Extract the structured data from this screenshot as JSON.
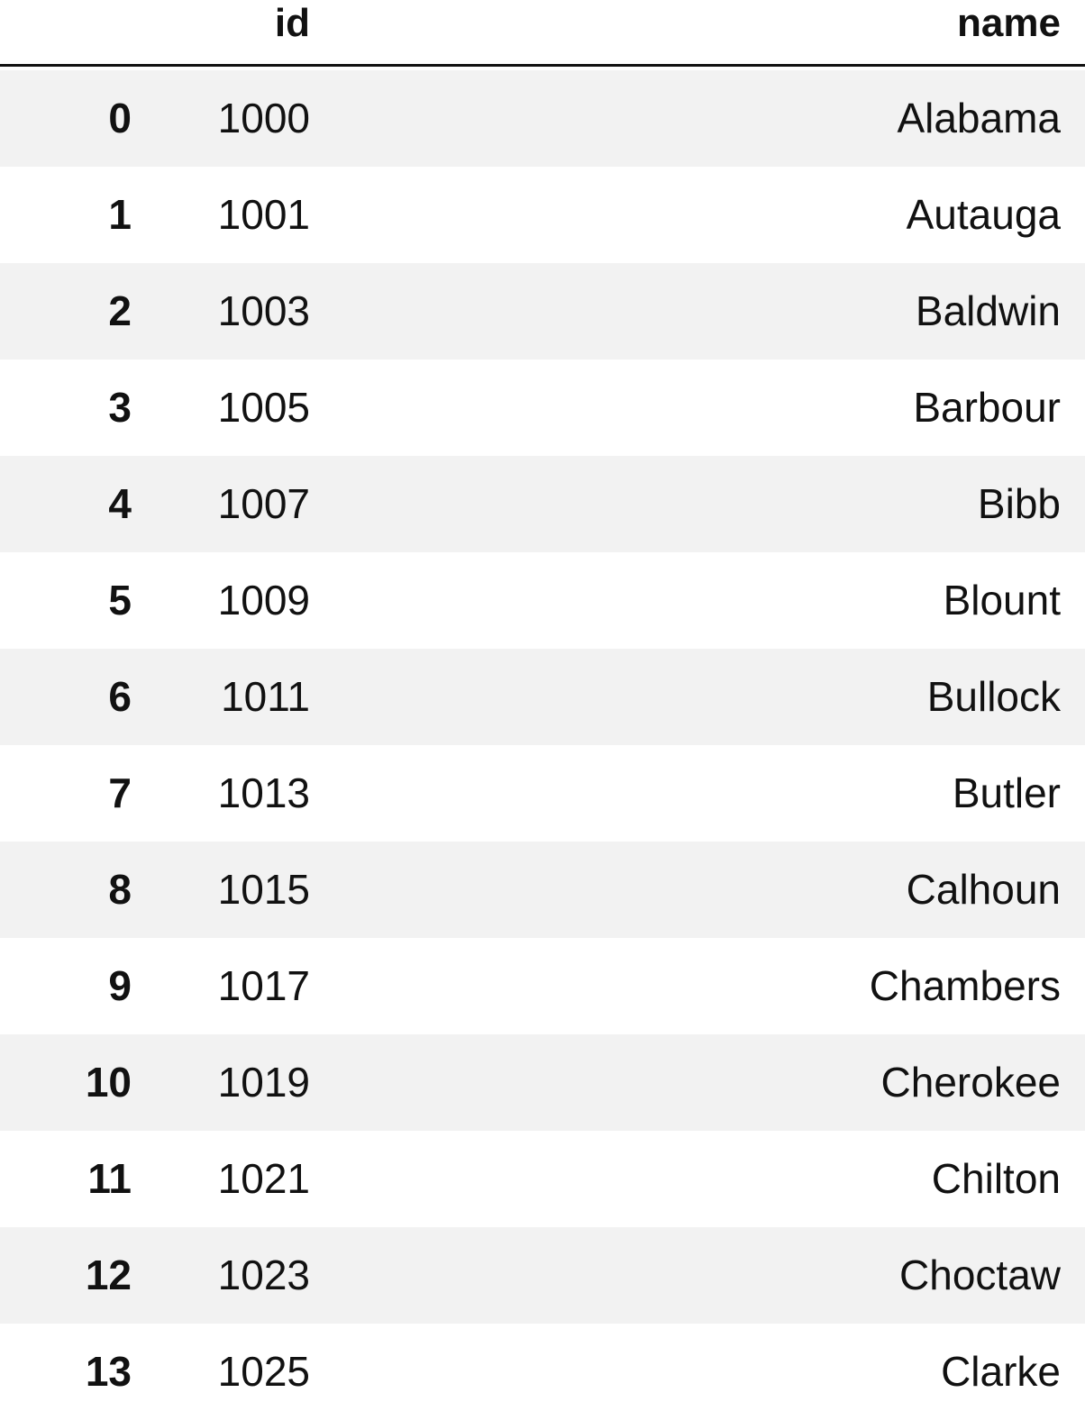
{
  "table": {
    "columns": {
      "index": "",
      "id": "id",
      "name": "name"
    },
    "rows": [
      {
        "index": "0",
        "id": "1000",
        "name": "Alabama"
      },
      {
        "index": "1",
        "id": "1001",
        "name": "Autauga"
      },
      {
        "index": "2",
        "id": "1003",
        "name": "Baldwin"
      },
      {
        "index": "3",
        "id": "1005",
        "name": "Barbour"
      },
      {
        "index": "4",
        "id": "1007",
        "name": "Bibb"
      },
      {
        "index": "5",
        "id": "1009",
        "name": "Blount"
      },
      {
        "index": "6",
        "id": "1011",
        "name": "Bullock"
      },
      {
        "index": "7",
        "id": "1013",
        "name": "Butler"
      },
      {
        "index": "8",
        "id": "1015",
        "name": "Calhoun"
      },
      {
        "index": "9",
        "id": "1017",
        "name": "Chambers"
      },
      {
        "index": "10",
        "id": "1019",
        "name": "Cherokee"
      },
      {
        "index": "11",
        "id": "1021",
        "name": "Chilton"
      },
      {
        "index": "12",
        "id": "1023",
        "name": "Choctaw"
      },
      {
        "index": "13",
        "id": "1025",
        "name": "Clarke"
      }
    ]
  },
  "colors": {
    "stripe": "#f2f2f2",
    "background": "#ffffff",
    "text": "#111111"
  }
}
